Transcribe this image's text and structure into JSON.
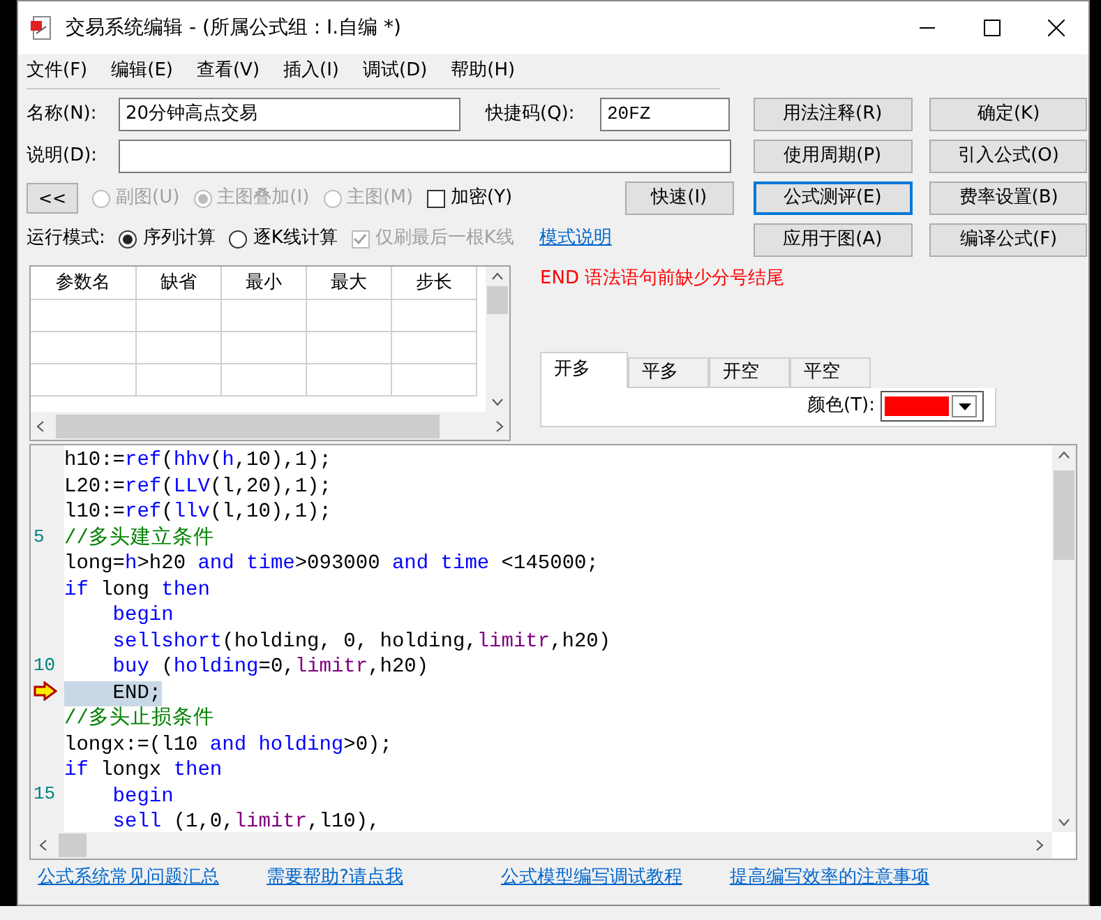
{
  "window": {
    "title": "交易系统编辑 - (所属公式组 : I.自编 *)"
  },
  "menu": [
    "文件(F)",
    "编辑(E)",
    "查看(V)",
    "插入(I)",
    "调试(D)",
    "帮助(H)"
  ],
  "form": {
    "name_label": "名称(N):",
    "name_value": "20分钟高点交易",
    "shortcut_label": "快捷码(Q):",
    "shortcut_value": "20FZ",
    "desc_label": "说明(D):"
  },
  "collapse_button": "<<",
  "chart_type": [
    {
      "label": "副图(U)",
      "selected": false,
      "disabled": true
    },
    {
      "label": "主图叠加(I)",
      "selected": true,
      "disabled": true
    },
    {
      "label": "主图(M)",
      "selected": false,
      "disabled": true
    }
  ],
  "encrypt": {
    "label": "加密(Y)",
    "checked": false
  },
  "fast_button": "快速(I)",
  "run_mode": {
    "label": "运行模式:",
    "options": [
      {
        "label": "序列计算",
        "selected": true
      },
      {
        "label": "逐K线计算",
        "selected": false
      }
    ],
    "refresh_last": {
      "label": "仅刷最后一根K线",
      "checked": true,
      "disabled": true
    },
    "help_link": "模式说明"
  },
  "buttons": [
    [
      {
        "label": "用法注释(R)",
        "focused": false
      },
      {
        "label": "确定(K)",
        "focused": false
      }
    ],
    [
      {
        "label": "使用周期(P)",
        "focused": false
      },
      {
        "label": "引入公式(O)",
        "focused": false
      }
    ],
    [
      {
        "label": "公式测评(E)",
        "focused": true
      },
      {
        "label": "费率设置(B)",
        "focused": false
      }
    ],
    [
      {
        "label": "应用于图(A)",
        "focused": false
      },
      {
        "label": "编译公式(F)",
        "focused": false
      }
    ]
  ],
  "param_table": {
    "columns": [
      "参数名",
      "缺省",
      "最小",
      "最大",
      "步长"
    ]
  },
  "error_message": "END 语法语句前缺少分号结尾",
  "signal_tabs": [
    {
      "label": "开多",
      "selected": true
    },
    {
      "label": "平多",
      "selected": false
    },
    {
      "label": "开空",
      "selected": false
    },
    {
      "label": "平空",
      "selected": false
    }
  ],
  "color_field": {
    "label": "颜色(T):",
    "color": "#ff0000"
  },
  "code_lines": [
    {
      "tokens": [
        {
          "kind": "plain",
          "text": "h10:="
        },
        {
          "kind": "keyword",
          "text": "ref"
        },
        {
          "kind": "plain",
          "text": "("
        },
        {
          "kind": "keyword",
          "text": "hhv"
        },
        {
          "kind": "plain",
          "text": "("
        },
        {
          "kind": "keyword",
          "text": "h"
        },
        {
          "kind": "plain",
          "text": ",10),1);"
        }
      ]
    },
    {
      "tokens": [
        {
          "kind": "plain",
          "text": "L20:="
        },
        {
          "kind": "keyword",
          "text": "ref"
        },
        {
          "kind": "plain",
          "text": "("
        },
        {
          "kind": "keyword",
          "text": "LLV"
        },
        {
          "kind": "plain",
          "text": "(l,20),1);"
        }
      ]
    },
    {
      "tokens": [
        {
          "kind": "plain",
          "text": "l10:="
        },
        {
          "kind": "keyword",
          "text": "ref"
        },
        {
          "kind": "plain",
          "text": "("
        },
        {
          "kind": "keyword",
          "text": "llv"
        },
        {
          "kind": "plain",
          "text": "(l,10),1);"
        }
      ]
    },
    {
      "number": "5",
      "tokens": [
        {
          "kind": "comment",
          "text": "//多头建立条件"
        }
      ]
    },
    {
      "tokens": [
        {
          "kind": "plain",
          "text": "long="
        },
        {
          "kind": "keyword",
          "text": "h"
        },
        {
          "kind": "plain",
          "text": ">h20 "
        },
        {
          "kind": "keyword",
          "text": "and time"
        },
        {
          "kind": "plain",
          "text": ">093000 "
        },
        {
          "kind": "keyword",
          "text": "and time"
        },
        {
          "kind": "plain",
          "text": " <145000;"
        }
      ]
    },
    {
      "tokens": [
        {
          "kind": "keyword",
          "text": "if"
        },
        {
          "kind": "plain",
          "text": " long "
        },
        {
          "kind": "keyword",
          "text": "then"
        }
      ]
    },
    {
      "tokens": [
        {
          "kind": "keyword",
          "text": "    begin"
        }
      ]
    },
    {
      "tokens": [
        {
          "kind": "keyword",
          "text": "    sellshort"
        },
        {
          "kind": "plain",
          "text": "(holding, 0, holding,"
        },
        {
          "kind": "param",
          "text": "limitr"
        },
        {
          "kind": "plain",
          "text": ",h20)"
        }
      ]
    },
    {
      "number": "10",
      "tokens": [
        {
          "kind": "keyword",
          "text": "    buy"
        },
        {
          "kind": "plain",
          "text": " ("
        },
        {
          "kind": "keyword",
          "text": "holding"
        },
        {
          "kind": "plain",
          "text": "=0,"
        },
        {
          "kind": "param",
          "text": "limitr"
        },
        {
          "kind": "plain",
          "text": ",h20)"
        }
      ]
    },
    {
      "current": true,
      "tokens": [
        {
          "kind": "plain",
          "text": "    END;"
        }
      ]
    },
    {
      "tokens": [
        {
          "kind": "comment",
          "text": "//多头止损条件"
        }
      ]
    },
    {
      "tokens": [
        {
          "kind": "plain",
          "text": "longx:=(l10 "
        },
        {
          "kind": "keyword",
          "text": "and holding"
        },
        {
          "kind": "plain",
          "text": ">0);"
        }
      ]
    },
    {
      "tokens": [
        {
          "kind": "keyword",
          "text": "if"
        },
        {
          "kind": "plain",
          "text": " longx "
        },
        {
          "kind": "keyword",
          "text": "then"
        }
      ]
    },
    {
      "number": "15",
      "tokens": [
        {
          "kind": "keyword",
          "text": "    begin"
        }
      ]
    },
    {
      "tokens": [
        {
          "kind": "keyword",
          "text": "    sell"
        },
        {
          "kind": "plain",
          "text": " (1,0,"
        },
        {
          "kind": "param",
          "text": "limitr"
        },
        {
          "kind": "plain",
          "text": ",l10),"
        }
      ]
    }
  ],
  "footer_links": [
    "公式系统常见问题汇总",
    "需要帮助?请点我",
    "公式模型编写调试教程",
    "提高编写效率的注意事项"
  ]
}
